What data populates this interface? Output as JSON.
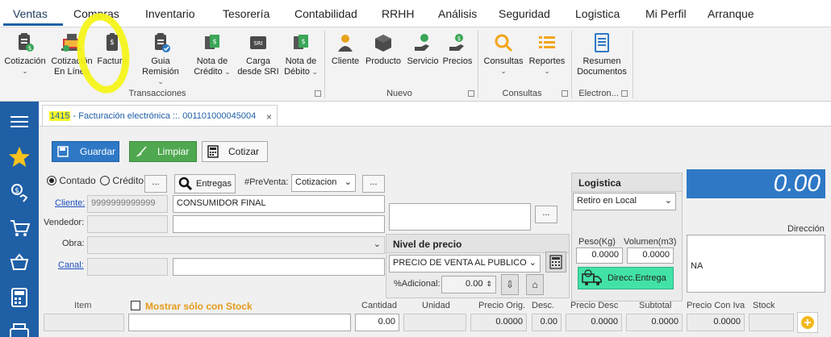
{
  "menu": {
    "tabs": [
      "Ventas",
      "Compras",
      "Inventario",
      "Tesorería",
      "Contabilidad",
      "RRHH",
      "Análisis",
      "Seguridad",
      "Logistica",
      "Mi Perfil",
      "Arranque"
    ]
  },
  "ribbon": {
    "transacciones": {
      "label": "Transacciones",
      "items": [
        {
          "line1": "Cotización",
          "line2": ""
        },
        {
          "line1": "Cotización",
          "line2": "En Línea"
        },
        {
          "line1": "Factura",
          "line2": ""
        },
        {
          "line1": "Guia Remisión",
          "line2": ""
        },
        {
          "line1": "Nota de",
          "line2": "Crédito"
        },
        {
          "line1": "Carga",
          "line2": "desde SRI"
        },
        {
          "line1": "Nota de",
          "line2": "Débito"
        }
      ]
    },
    "nuevo": {
      "label": "Nuevo",
      "items": [
        "Cliente",
        "Producto",
        "Servicio",
        "Precios"
      ]
    },
    "consultas": {
      "label": "Consultas",
      "items": [
        "Consultas",
        "Reportes"
      ]
    },
    "electron": {
      "label": "Electron...",
      "items": [
        {
          "line1": "Resumen",
          "line2": "Documentos"
        }
      ]
    },
    "sri_badge": "SRI"
  },
  "doc_tab": {
    "number": "1415",
    "title": " - Facturación electrónica ::. 001101000045004",
    "close": "×"
  },
  "toolbar": {
    "guardar": "Guardar",
    "limpiar": "Limpiar",
    "cotizar": "Cotizar"
  },
  "form": {
    "contado": "Contado",
    "credito": "Crédito",
    "ellipsis": "...",
    "entregas": "Entregas",
    "preventa_label": "#PreVenta:",
    "preventa_value": "Cotizacion",
    "cliente_label": "Cliente:",
    "cliente_ruc": "9999999999999",
    "cliente_nombre": "CONSUMIDOR FINAL",
    "vendedor_label": "Vendedor:",
    "obra_label": "Obra:",
    "canal_label": "Canal:"
  },
  "nivel_precio": {
    "header": "Nivel de precio",
    "value": "PRECIO DE VENTA AL PUBLICO",
    "adicional_label": "%Adicional:",
    "adicional_value": "0.00"
  },
  "logistica": {
    "header": "Logistica",
    "value": "Retiro en Local",
    "peso_label": "Peso(Kg)",
    "volumen_label": "Volumen(m3)",
    "peso_value": "0.0000",
    "volumen_value": "0.0000",
    "direcc_button": "Direcc.Entrega"
  },
  "total": "0.00",
  "direccion": {
    "label": "Dirección",
    "value": "NA"
  },
  "grid": {
    "headers": [
      "Item",
      "Mostrar sólo con Stock",
      "Cantidad",
      "Unidad",
      "Precio Orig.",
      "Desc.",
      "Precio Desc",
      "Subtotal",
      "Precio Con Iva",
      "Stock"
    ],
    "cantidad": "0.00",
    "precio_orig": "0.0000",
    "desc": "0.00",
    "precio_desc": "0.0000",
    "subtotal": "0.0000",
    "precio_con_iva": "0.0000"
  },
  "colors": {
    "primary": "#1f5fa6",
    "highlight": "#f4f41a",
    "save_button": "#2e78c6",
    "clear_button": "#4fa84f",
    "total_bg": "#2e78c6",
    "direcc_bg": "#42e2a6"
  }
}
